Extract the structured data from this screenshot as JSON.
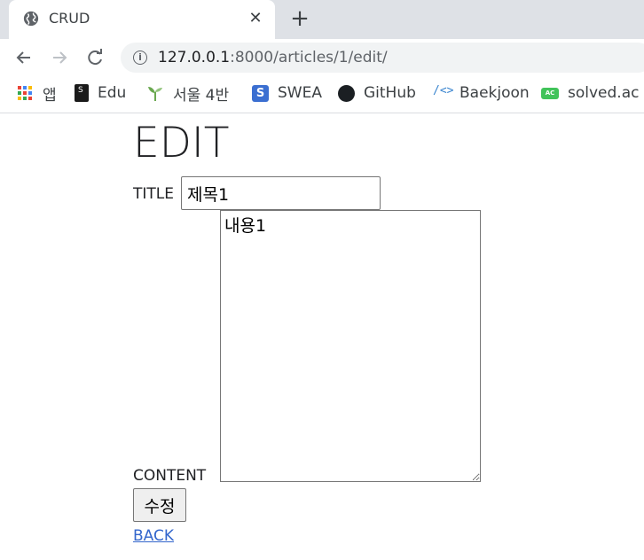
{
  "tab": {
    "title": "CRUD",
    "close_glyph": "✕",
    "new_tab_glyph": "+"
  },
  "toolbar": {
    "url_host": "127.0.0.1",
    "url_path": ":8000/articles/1/edit/"
  },
  "bookmarks": [
    {
      "label": "앱",
      "icon": "apps-grid-icon"
    },
    {
      "label": "Edu",
      "icon": "edu-icon"
    },
    {
      "label": "서울 4반",
      "icon": "sprout-icon"
    },
    {
      "label": "SWEA",
      "icon": "swea-icon"
    },
    {
      "label": "GitHub",
      "icon": "github-icon"
    },
    {
      "label": "Baekjoon",
      "icon": "code-brackets-icon"
    },
    {
      "label": "solved.ac",
      "icon": "solved-ac-icon"
    }
  ],
  "form": {
    "heading": "EDIT",
    "title_label": "TITLE",
    "title_value": "제목1",
    "content_label": "CONTENT",
    "content_value": "내용1",
    "submit_label": "수정",
    "back_label": "BACK"
  },
  "colors": {
    "tab_strip": "#dee1e6",
    "omnibox": "#f1f3f4",
    "link": "#3366cc"
  }
}
